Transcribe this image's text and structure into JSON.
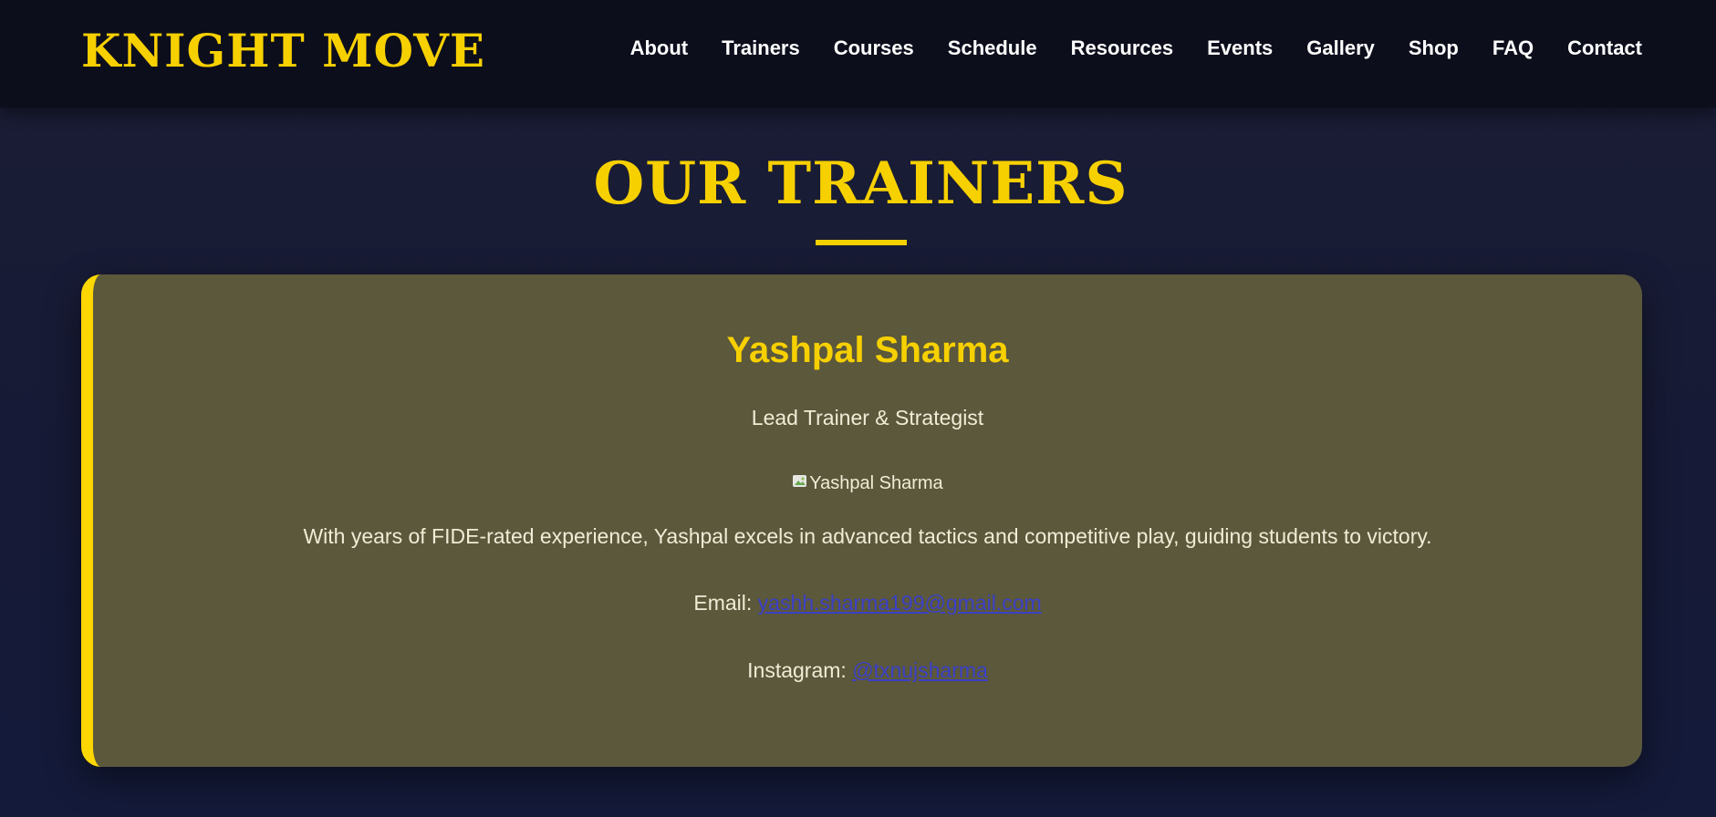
{
  "header": {
    "brand": "KNIGHT MOVE",
    "nav": [
      "About",
      "Trainers",
      "Courses",
      "Schedule",
      "Resources",
      "Events",
      "Gallery",
      "Shop",
      "FAQ",
      "Contact"
    ]
  },
  "section": {
    "title": "OUR TRAINERS"
  },
  "trainer": {
    "name": "Yashpal Sharma",
    "role": "Lead Trainer & Strategist",
    "image_alt": "Yashpal Sharma",
    "bio": "With years of FIDE-rated experience, Yashpal excels in advanced tactics and competitive play, guiding students to victory.",
    "email_label": "Email: ",
    "email": "yashh.sharma199@gmail.com",
    "instagram_label": "Instagram: ",
    "instagram": "@txnujsharma"
  },
  "colors": {
    "accent": "#f7d000",
    "card_bg": "#5b583c",
    "header_bg": "#0c0e1c",
    "link": "#3b40c6"
  }
}
